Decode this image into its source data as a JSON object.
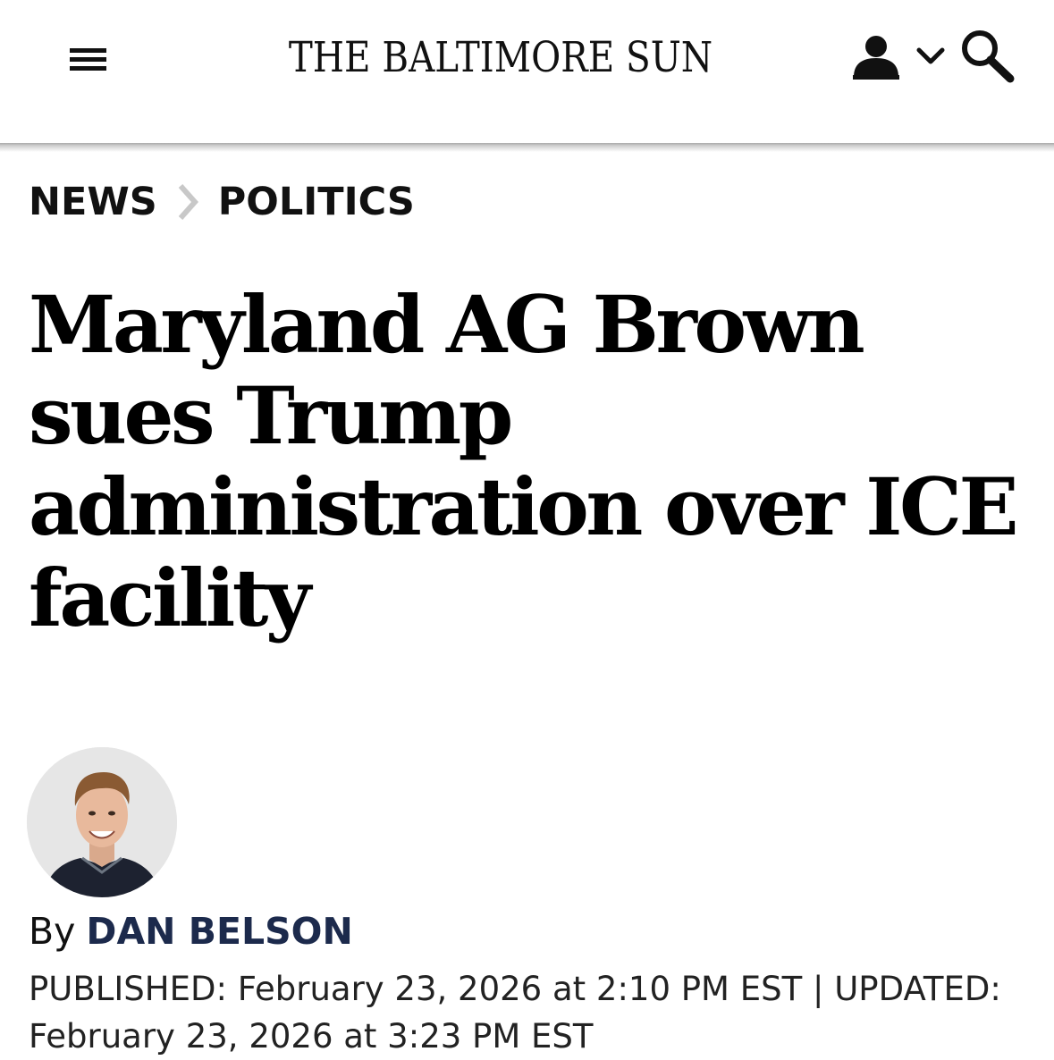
{
  "header": {
    "masthead": "THE BALTIMORE SUN",
    "menu_icon": "hamburger-menu-icon",
    "account_icon": "user-icon",
    "account_chevron_icon": "chevron-down-icon",
    "search_icon": "search-icon"
  },
  "breadcrumb": {
    "items": [
      {
        "label": "NEWS"
      },
      {
        "label": "POLITICS"
      }
    ],
    "separator_icon": "chevron-right-icon",
    "separator_color": "#c8c8c8"
  },
  "article": {
    "headline": "Maryland AG Brown sues Trump administration over ICE facility",
    "byline_prefix": "By",
    "author": "DAN BELSON",
    "author_color": "#1c2a4c",
    "published_label": "PUBLISHED:",
    "published": "February 23, 2026 at 2:10 PM EST",
    "separator": "|",
    "updated_label": "UPDATED:",
    "updated": "February 23, 2026 at 3:23 PM EST"
  }
}
